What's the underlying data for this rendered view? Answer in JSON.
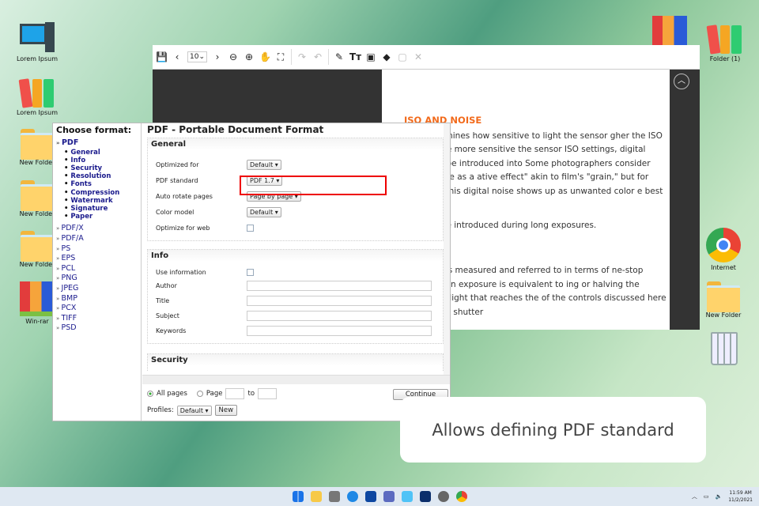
{
  "desktop": {
    "left_icons": [
      "Lorem Ipsum",
      "Lorem Ipsum",
      "New Folder",
      "New Folder",
      "New Folder",
      "Win-rar"
    ],
    "right_icons": [
      "Folder (1)",
      "Internet",
      "New Folder"
    ]
  },
  "viewer": {
    "zoom_value": "10",
    "icons": [
      "save-icon",
      "prev-icon",
      "next-icon",
      "zoom-out-icon",
      "zoom-in-icon",
      "hand-icon",
      "fullscreen-icon",
      "redo-icon",
      "undo-icon",
      "pen-icon",
      "text-icon",
      "image-icon",
      "shapes-icon",
      "copy-icon",
      "close-icon"
    ],
    "heading": "ISO AND NOISE",
    "paragraphs": [
      "ting determines how sensitive to light the sensor gher the ISO setting, the more sensitive the sensor ISO settings, digital noise can be introduced into Some photographers consider digital noise as a ative effect\" akin to film's \"grain,\" but for most ers, this digital noise shows up as unwanted color e best avoided.",
      "can also be introduced during long exposures.",
      "phy, light is measured and referred to in terms of ne-stop difference in exposure is equivalent to ing or halving the amount of light that reaches the of the controls discussed here—aperture, shutter"
    ]
  },
  "dialog": {
    "choose_format": "Choose format:",
    "formats": [
      "PDF",
      "PDF/X",
      "PDF/A",
      "PS",
      "EPS",
      "PCL",
      "PNG",
      "JPEG",
      "BMP",
      "PCX",
      "TIFF",
      "PSD"
    ],
    "pdf_sections": [
      "General",
      "Info",
      "Security",
      "Resolution",
      "Fonts",
      "Compression",
      "Watermark",
      "Signature",
      "Paper"
    ],
    "title": "PDF - Portable Document Format",
    "general": {
      "heading": "General",
      "optimized_for_label": "Optimized for",
      "optimized_for": "Default",
      "pdf_standard_label": "PDF standard",
      "pdf_standard": "PDF 1.7",
      "auto_rotate_label": "Auto rotate pages",
      "auto_rotate": "Page by page",
      "color_model_label": "Color model",
      "color_model": "Default",
      "optimize_web_label": "Optimize for web"
    },
    "info": {
      "heading": "Info",
      "use_info_label": "Use information",
      "author_label": "Author",
      "title_label": "Title",
      "subject_label": "Subject",
      "keywords_label": "Keywords"
    },
    "security_heading": "Security",
    "all_pages": "All pages",
    "page": "Page",
    "to": "to",
    "profiles_label": "Profiles:",
    "profile": "Default",
    "new_label": "New",
    "continue_label": "Continue"
  },
  "caption": "Allows defining PDF standard",
  "tray": {
    "time": "11:59 AM",
    "date": "11/2/2021"
  },
  "colors": {
    "highlight": "#e00000",
    "heading_orange": "#f26a1b",
    "format_link": "#1a1a8c"
  }
}
